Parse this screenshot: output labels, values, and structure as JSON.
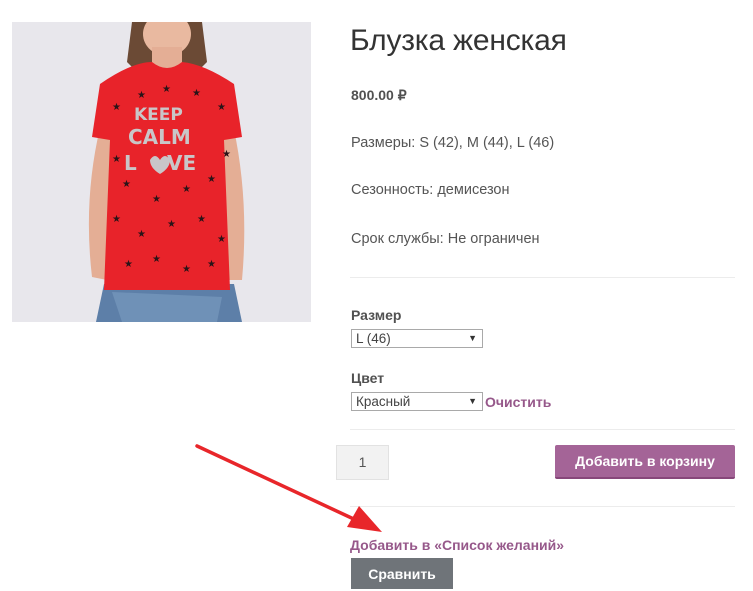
{
  "product": {
    "title": "Блузка женская",
    "price": "800.00 ₽",
    "image_shirt_text": [
      "KEEP",
      "CALM",
      "L",
      "VE"
    ],
    "attributes": [
      "Размеры: S (42), M (44), L (46)",
      "Сезонность: демисезон",
      "Срок службы: Не ограничен"
    ]
  },
  "variations": {
    "size": {
      "label": "Размер",
      "selected": "L (46)"
    },
    "color": {
      "label": "Цвет",
      "selected": "Красный"
    },
    "clear_label": "Очистить"
  },
  "cart": {
    "quantity": "1",
    "add_to_cart_label": "Добавить в корзину"
  },
  "wishlist_label": "Добавить в «Список желаний»",
  "compare_label": "Сравнить",
  "colors": {
    "accent": "#96588a",
    "button": "#a46497",
    "compare_button": "#6f7479",
    "shirt": "#e8232a",
    "arrow": "#e8262a"
  }
}
